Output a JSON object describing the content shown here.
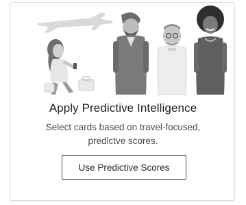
{
  "card": {
    "title": "Apply Predictive Intelligence",
    "description": "Select cards based on travel-focused, predictve scores.",
    "button_label": "Use Predictive Scores"
  },
  "colors": {
    "border": "#dcdcdc",
    "title_text": "#1e1e1e",
    "body_text": "#4a4a4a",
    "button_border": "#4a4a4a"
  }
}
